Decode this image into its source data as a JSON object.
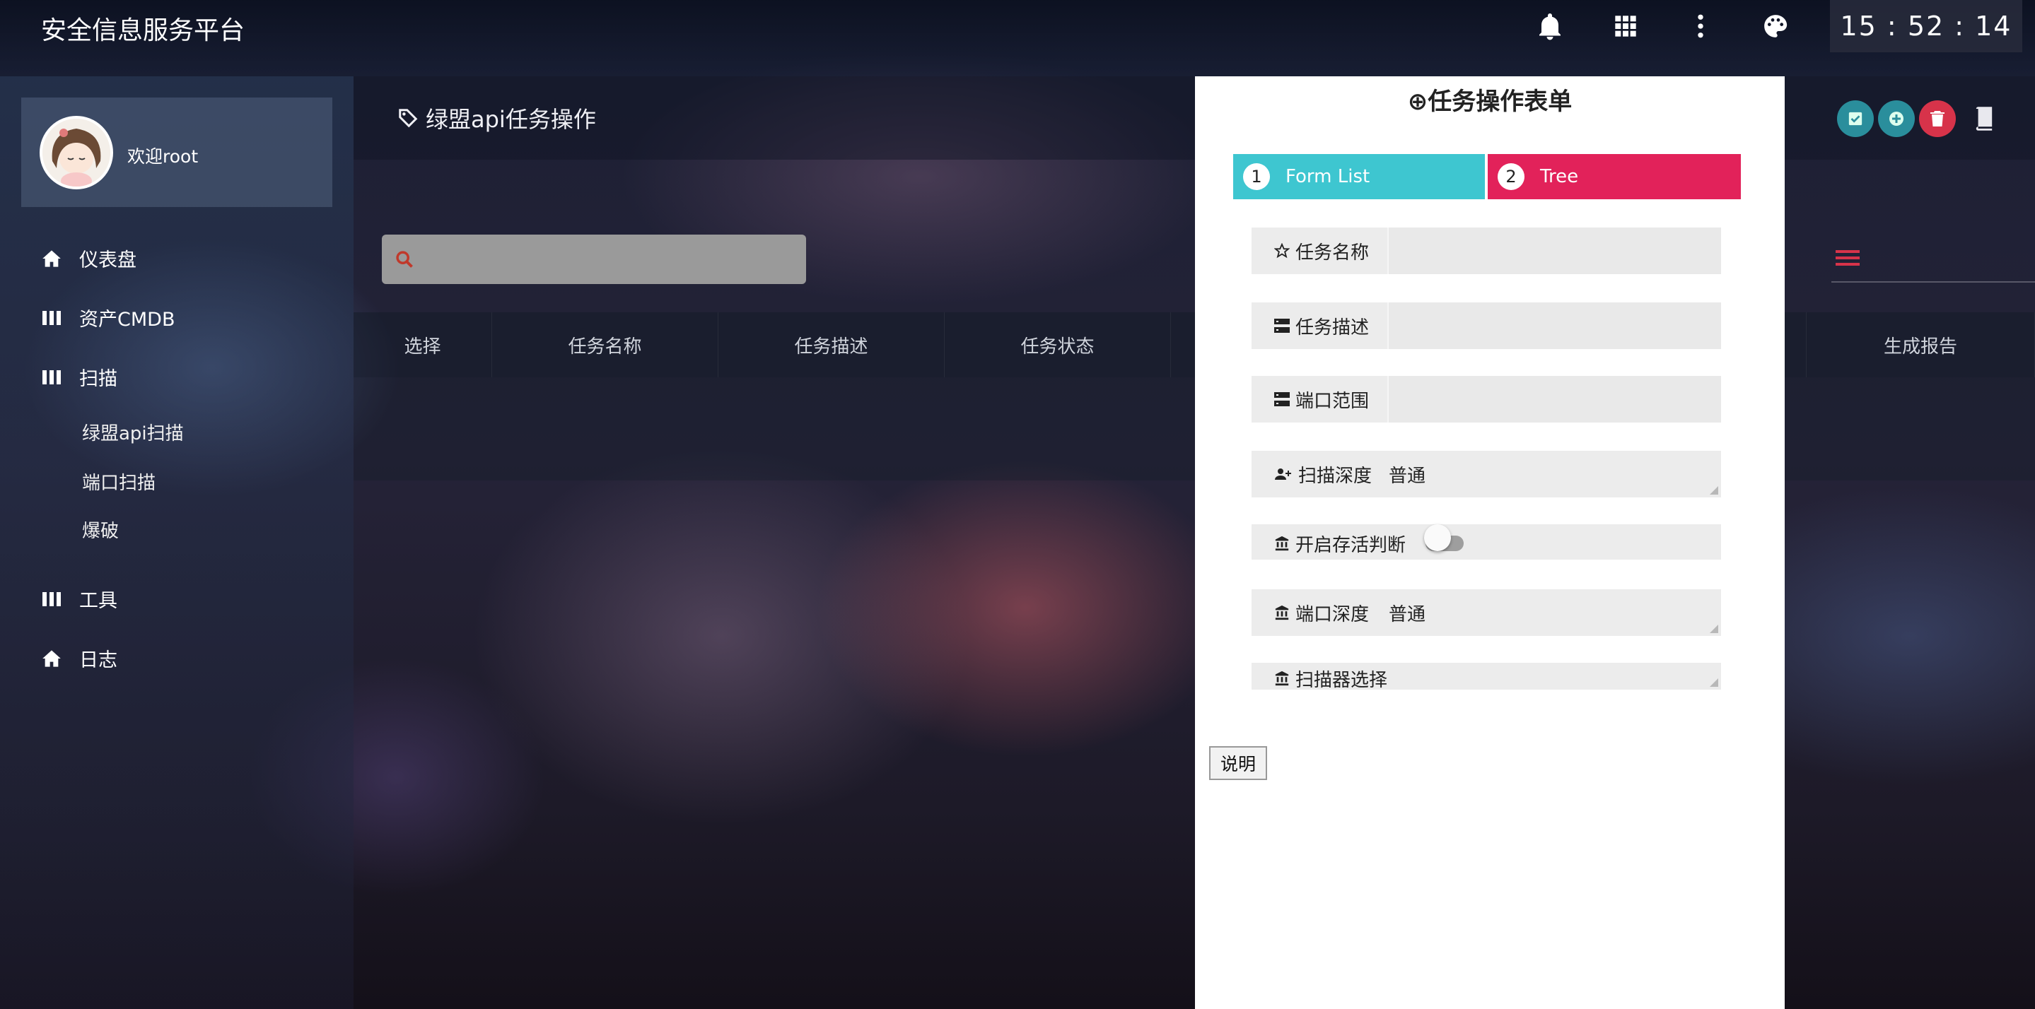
{
  "header": {
    "app_title": "安全信息服务平台",
    "clock": "15 : 52 : 14"
  },
  "sidebar": {
    "welcome": "欢迎root",
    "items": [
      {
        "label": "仪表盘",
        "icon": "home-icon"
      },
      {
        "label": "资产CMDB",
        "icon": "columns-icon"
      },
      {
        "label": "扫描",
        "icon": "columns-icon"
      },
      {
        "label": "工具",
        "icon": "columns-icon"
      },
      {
        "label": "日志",
        "icon": "home-icon"
      }
    ],
    "sub_items": [
      "绿盟api扫描",
      "端口扫描",
      "爆破"
    ]
  },
  "page": {
    "title": "绿盟api任务操作",
    "search_placeholder": ""
  },
  "table": {
    "columns": [
      "选择",
      "任务名称",
      "任务描述",
      "任务状态",
      "生成报告"
    ]
  },
  "modal": {
    "title": "⊕任务操作表单",
    "steps": [
      {
        "num": "1",
        "label": "Form List",
        "color": "#3ec6d0"
      },
      {
        "num": "2",
        "label": "Tree",
        "color": "#e2225a"
      }
    ],
    "fields": {
      "task_name": "任务名称",
      "task_desc": "任务描述",
      "port_range": "端口范围",
      "scan_depth": "扫描深度",
      "scan_depth_value": "普通",
      "alive_check": "开启存活判断",
      "port_depth": "端口深度",
      "port_depth_value": "普通",
      "scanner_select": "扫描器选择"
    },
    "help_button": "说明"
  },
  "colors": {
    "accent_teal": "#2a9aa8",
    "accent_red": "#d7334a",
    "search_icon": "#c0392b"
  }
}
